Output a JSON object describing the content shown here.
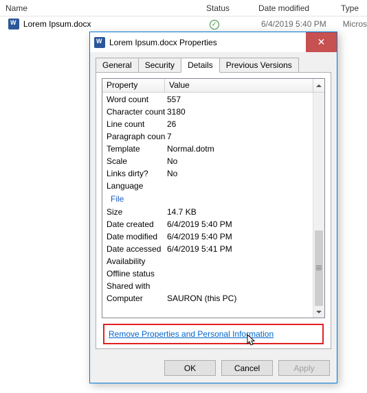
{
  "explorer": {
    "columns": {
      "name": "Name",
      "status": "Status",
      "date": "Date modified",
      "type": "Type"
    },
    "row": {
      "name": "Lorem Ipsum.docx",
      "date": "6/4/2019 5:40 PM",
      "type": "Micros"
    }
  },
  "dialog": {
    "title": "Lorem Ipsum.docx Properties",
    "close": "✕",
    "tabs": {
      "general": "General",
      "security": "Security",
      "details": "Details",
      "previous": "Previous Versions"
    },
    "headers": {
      "property": "Property",
      "value": "Value"
    },
    "rows": [
      {
        "p": "Word count",
        "v": "557"
      },
      {
        "p": "Character count",
        "v": "3180"
      },
      {
        "p": "Line count",
        "v": "26"
      },
      {
        "p": "Paragraph count",
        "v": "7"
      },
      {
        "p": "Template",
        "v": "Normal.dotm"
      },
      {
        "p": "Scale",
        "v": "No"
      },
      {
        "p": "Links dirty?",
        "v": "No"
      },
      {
        "p": "Language",
        "v": ""
      }
    ],
    "section": "File",
    "rows2": [
      {
        "p": "Size",
        "v": "14.7 KB"
      },
      {
        "p": "Date created",
        "v": "6/4/2019 5:40 PM"
      },
      {
        "p": "Date modified",
        "v": "6/4/2019 5:40 PM"
      },
      {
        "p": "Date accessed",
        "v": "6/4/2019 5:41 PM"
      },
      {
        "p": "Availability",
        "v": ""
      },
      {
        "p": "Offline status",
        "v": ""
      },
      {
        "p": "Shared with",
        "v": ""
      },
      {
        "p": "Computer",
        "v": "SAURON (this PC)"
      }
    ],
    "removeLink": "Remove Properties and Personal Information",
    "buttons": {
      "ok": "OK",
      "cancel": "Cancel",
      "apply": "Apply"
    }
  }
}
